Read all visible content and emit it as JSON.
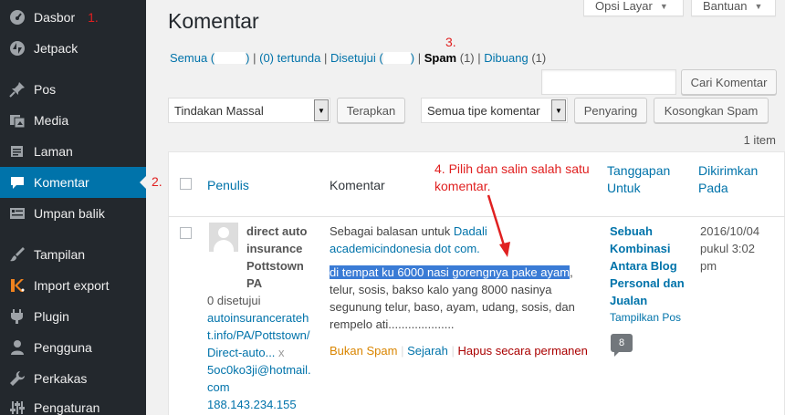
{
  "sidebar": {
    "items": [
      {
        "label": "Dasbor",
        "icon": "dashboard-icon"
      },
      {
        "label": "Jetpack",
        "icon": "jetpack-icon"
      },
      {
        "label": "Pos",
        "icon": "pin-icon"
      },
      {
        "label": "Media",
        "icon": "media-icon"
      },
      {
        "label": "Laman",
        "icon": "page-icon"
      },
      {
        "label": "Komentar",
        "icon": "comment-icon"
      },
      {
        "label": "Umpan balik",
        "icon": "feedback-icon"
      },
      {
        "label": "Tampilan",
        "icon": "brush-icon"
      },
      {
        "label": "Import export",
        "icon": "import-export-icon"
      },
      {
        "label": "Plugin",
        "icon": "plug-icon"
      },
      {
        "label": "Pengguna",
        "icon": "user-icon"
      },
      {
        "label": "Perkakas",
        "icon": "wrench-icon"
      },
      {
        "label": "Pengaturan",
        "icon": "settings-icon"
      }
    ],
    "active_color": "#0073aa"
  },
  "annotations": {
    "step1": "1.",
    "step2": "2.",
    "step3": "3.",
    "step4": "4. Pilih dan salin salah satu komentar."
  },
  "header": {
    "title": "Komentar",
    "screen_options": "Opsi Layar",
    "help": "Bantuan"
  },
  "filters": {
    "all": "Semua (",
    "all_close": ")",
    "pending": "(0) tertunda",
    "approved": "Disetujui (",
    "approved_close": ")",
    "spam": "Spam",
    "spam_count": "(1)",
    "trash": "Dibuang",
    "trash_count": "(1)"
  },
  "search": {
    "button": "Cari Komentar",
    "value": ""
  },
  "toolbar": {
    "bulk_action": "Tindakan Massal",
    "apply": "Terapkan",
    "comment_type": "Semua tipe komentar",
    "filter": "Penyaring",
    "empty_spam": "Kosongkan Spam"
  },
  "items_count": "1 item",
  "table": {
    "columns": {
      "author": "Penulis",
      "comment": "Komentar",
      "response": "Tanggapan Untuk",
      "submitted": "Dikirimkan Pada"
    },
    "row": {
      "author_name": "direct auto insurance Pottstown PA",
      "approved_count": "0 disetujui",
      "author_url": "autoinsurancerateht.info/PA/Pottstown/Direct-auto...",
      "author_email": "5oc0ko3ji@hotmail.com",
      "author_ip": "188.143.234.155",
      "reply_prefix": "Sebagai balasan untuk",
      "reply_to": "Dadali academicindonesia dot com.",
      "comment_selected": "di tempat ku 6000 nasi gorengnya pake ayam",
      "comment_rest": ", telur, sosis, bakso kalo yang 8000 nasinya segunung telur, baso, ayam, udang, sosis, dan rempelo ati....................",
      "action_not_spam": "Bukan Spam",
      "action_history": "Sejarah",
      "action_delete": "Hapus secara permanen",
      "post_title": "Sebuah Kombinasi Antara Blog Personal dan Jualan",
      "view_post": "Tampilkan Pos",
      "comment_count": "8",
      "date": "2016/10/04 pukul 3:02 pm"
    }
  }
}
